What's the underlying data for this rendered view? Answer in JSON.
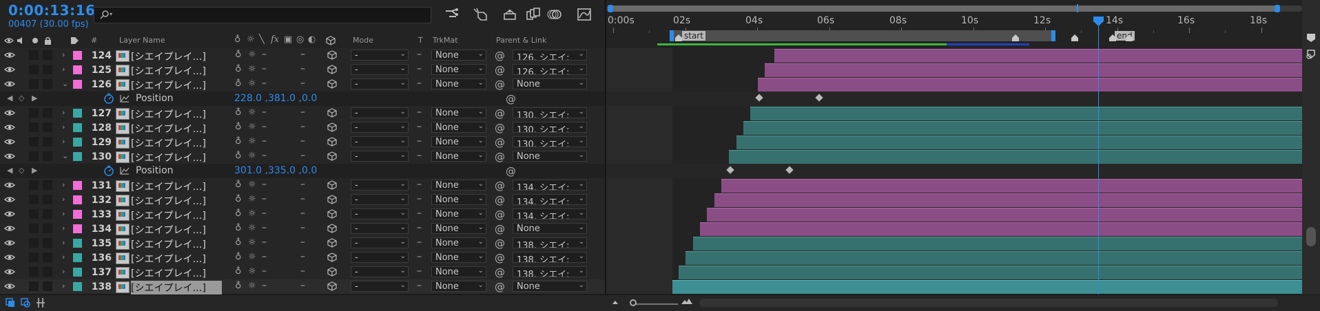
{
  "header": {
    "timecode": "0:00:13:16",
    "frames": "00407 (30.00 fps)",
    "search_placeholder": ""
  },
  "columns": {
    "hash": "#",
    "layer_name": "Layer Name",
    "fx": "fx",
    "mode": "Mode",
    "t": "T",
    "trkmat": "TrkMat",
    "parent": "Parent & Link"
  },
  "layers": [
    {
      "num": "124",
      "name": "[シエイプレイ…]",
      "label": "pink",
      "mode": "-",
      "trkmat": "None",
      "parent": "126. シエイ:",
      "expanded": false
    },
    {
      "num": "125",
      "name": "[シエイプレイ…]",
      "label": "pink",
      "mode": "-",
      "trkmat": "None",
      "parent": "126. シエイ:",
      "expanded": false
    },
    {
      "num": "126",
      "name": "[シエイプレイ…]",
      "label": "pink",
      "mode": "-",
      "trkmat": "None",
      "parent": "None",
      "expanded": true
    },
    {
      "prop": true,
      "prop_name": "Position",
      "value": "228.0 ,381.0 ,0.0"
    },
    {
      "num": "127",
      "name": "[シエイプレイ…]",
      "label": "teal",
      "mode": "-",
      "trkmat": "None",
      "parent": "130. シエイ:",
      "expanded": false
    },
    {
      "num": "128",
      "name": "[シエイプレイ…]",
      "label": "teal",
      "mode": "-",
      "trkmat": "None",
      "parent": "130. シエイ:",
      "expanded": false
    },
    {
      "num": "129",
      "name": "[シエイプレイ…]",
      "label": "teal",
      "mode": "-",
      "trkmat": "None",
      "parent": "130. シエイ:",
      "expanded": false
    },
    {
      "num": "130",
      "name": "[シエイプレイ…]",
      "label": "teal",
      "mode": "-",
      "trkmat": "None",
      "parent": "None",
      "expanded": true
    },
    {
      "prop": true,
      "prop_name": "Position",
      "value": "301.0 ,335.0 ,0.0"
    },
    {
      "num": "131",
      "name": "[シエイプレイ…]",
      "label": "pink",
      "mode": "-",
      "trkmat": "None",
      "parent": "134. シエイ:",
      "expanded": false
    },
    {
      "num": "132",
      "name": "[シエイプレイ…]",
      "label": "pink",
      "mode": "-",
      "trkmat": "None",
      "parent": "134. シエイ:",
      "expanded": false
    },
    {
      "num": "133",
      "name": "[シエイプレイ…]",
      "label": "pink",
      "mode": "-",
      "trkmat": "None",
      "parent": "134. シエイ:",
      "expanded": false
    },
    {
      "num": "134",
      "name": "[シエイプレイ…]",
      "label": "pink",
      "mode": "-",
      "trkmat": "None",
      "parent": "None",
      "expanded": false
    },
    {
      "num": "135",
      "name": "[シエイプレイ…]",
      "label": "teal",
      "mode": "-",
      "trkmat": "None",
      "parent": "138. シエイ:",
      "expanded": false
    },
    {
      "num": "136",
      "name": "[シエイプレイ…]",
      "label": "teal",
      "mode": "-",
      "trkmat": "None",
      "parent": "138. シエイ:",
      "expanded": false
    },
    {
      "num": "137",
      "name": "[シエイプレイ…]",
      "label": "teal",
      "mode": "-",
      "trkmat": "None",
      "parent": "138. シエイ:",
      "expanded": false
    },
    {
      "num": "138",
      "name": "[シエイプレイ…]",
      "label": "teal",
      "mode": "-",
      "trkmat": "None",
      "parent": "None",
      "expanded": false,
      "selected": true
    }
  ],
  "ruler": {
    "labels": [
      "0:00s",
      "02s",
      "04s",
      "06s",
      "08s",
      "10s",
      "12s",
      "14s",
      "16s",
      "18s"
    ]
  },
  "markers": {
    "start": "start",
    "end": "end"
  },
  "colors": {
    "accent": "#2d8ceb",
    "label_pink": "#f06ed6",
    "label_teal": "#3aa7a3",
    "bar_pink": "#8a4d86",
    "bar_teal": "#37716f",
    "bar_selected": "#3d8f93"
  },
  "icons": [
    "eye-icon",
    "speaker-icon",
    "solo-icon",
    "lock-icon",
    "label-tag-icon",
    "stopwatch-icon",
    "graph-icon",
    "pickwhip-icon",
    "cube-icon",
    "search-icon"
  ]
}
